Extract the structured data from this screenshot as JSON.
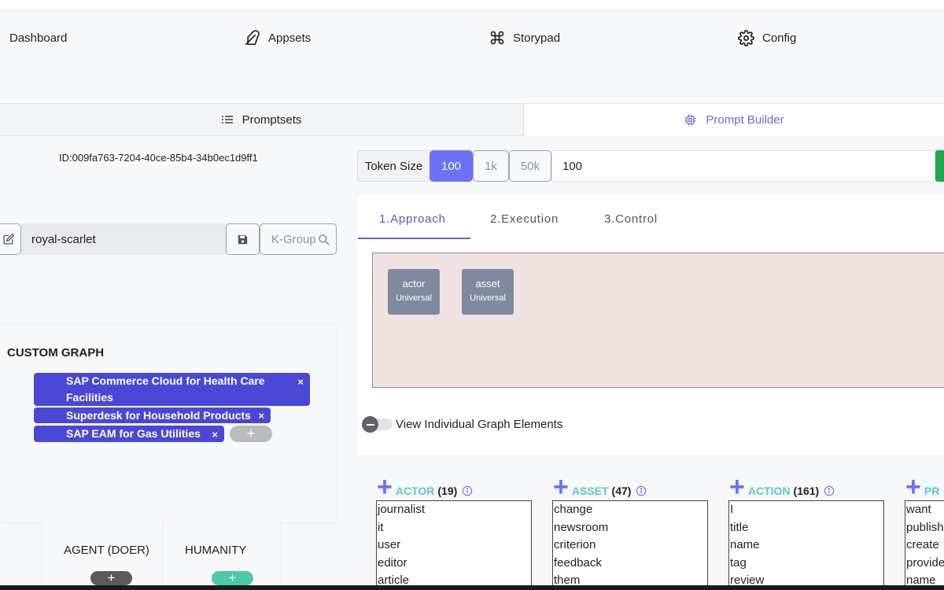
{
  "nav": {
    "dashboard": "Dashboard",
    "appsets": "Appsets",
    "storypad": "Storypad",
    "config": "Config"
  },
  "tabs": {
    "promptsets": "Promptsets",
    "prompt_builder": "Prompt Builder"
  },
  "id_text": "ID:009fa763-7204-40ce-85b4-34b0ec1d9ff1",
  "token": {
    "label": "Token Size",
    "options": [
      "100",
      "1k",
      "50k"
    ],
    "selected": "100",
    "value": "100"
  },
  "name_field": {
    "value": "royal-scarlet",
    "kgroup_label": "K-Group"
  },
  "custom_graph": {
    "title": "CUSTOM GRAPH",
    "chips": [
      "SAP Commerce Cloud for Health Care Facilities",
      "Superdesk for Household Products",
      "SAP EAM for Gas Utilities"
    ],
    "add_symbol": "+"
  },
  "bottom_cards": [
    {
      "title": "AGENT (DOER)",
      "button": "+",
      "color": "#5a5a5a"
    },
    {
      "title": "HUMANITY",
      "button": "+",
      "color": "#4cc9a8"
    }
  ],
  "subtabs": [
    "1.Approach",
    "2.Execution",
    "3.Control"
  ],
  "nodes": [
    {
      "name": "actor",
      "scope": "Universal"
    },
    {
      "name": "asset",
      "scope": "Universal"
    }
  ],
  "toggle_label": "View Individual Graph Elements",
  "categories": [
    {
      "name": "ACTOR",
      "count": "(19)",
      "items": [
        "journalist",
        "it",
        "user",
        "editor",
        "article"
      ]
    },
    {
      "name": "ASSET",
      "count": "(47)",
      "items": [
        "change",
        "newsroom",
        "criterion",
        "feedback",
        "them"
      ]
    },
    {
      "name": "ACTION",
      "count": "(161)",
      "items": [
        "I",
        "title",
        "name",
        "tag",
        "review"
      ]
    },
    {
      "name": "PR",
      "count": "",
      "items": [
        "want",
        "publish",
        "create",
        "provide",
        "name"
      ]
    }
  ],
  "colors": {
    "accent": "#6c72f5",
    "chip": "#4b47d6",
    "tab_accent": "#6b4fbb",
    "category_name": "#5bc8c8"
  }
}
